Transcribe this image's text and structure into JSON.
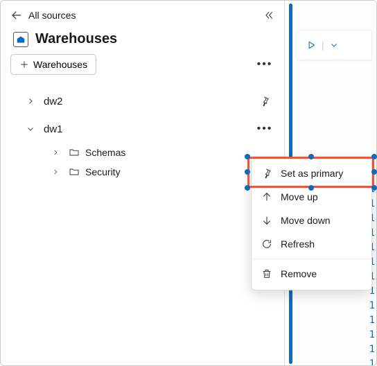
{
  "header": {
    "back_label": "All sources",
    "title": "Warehouses"
  },
  "add_button_label": "Warehouses",
  "tree": {
    "items": [
      {
        "label": "dw2",
        "expanded": false
      },
      {
        "label": "dw1",
        "expanded": true
      }
    ],
    "children": [
      {
        "label": "Schemas"
      },
      {
        "label": "Security"
      }
    ]
  },
  "context_menu": {
    "set_primary": "Set as primary",
    "move_up": "Move up",
    "move_down": "Move down",
    "refresh": "Refresh",
    "remove": "Remove"
  },
  "line_numbers": [
    "1",
    "1",
    "1",
    "1",
    "1",
    "1",
    "1",
    "1",
    "1",
    "1",
    "1",
    "1",
    "1"
  ]
}
